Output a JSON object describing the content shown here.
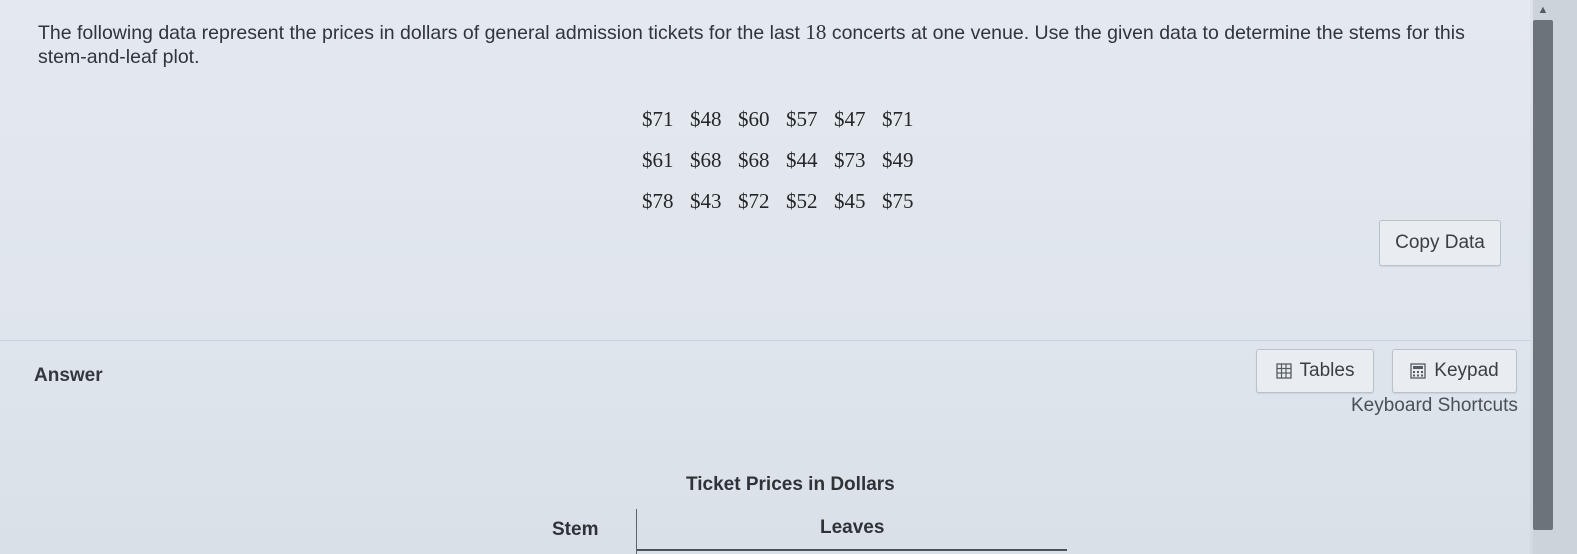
{
  "question": {
    "text_before": "The following data represent the prices in dollars of general admission tickets for the last ",
    "count": "18",
    "text_after": " concerts at one venue. Use the given data to determine the stems for this stem-and-leaf plot."
  },
  "prices": [
    [
      "$71",
      "$48",
      "$60",
      "$57",
      "$47",
      "$71"
    ],
    [
      "$61",
      "$68",
      "$68",
      "$44",
      "$73",
      "$49"
    ],
    [
      "$78",
      "$43",
      "$72",
      "$52",
      "$45",
      "$75"
    ]
  ],
  "copy_data_label": "Copy Data",
  "answer": {
    "label": "Answer",
    "tables_label": "Tables",
    "keypad_label": "Keypad",
    "shortcuts_label": "Keyboard Shortcuts",
    "plot_title": "Ticket Prices in Dollars",
    "stem_header": "Stem",
    "leaves_header": "Leaves"
  },
  "icons": {
    "tables": "table-grid-icon",
    "keypad": "calculator-icon",
    "scroll_up": "chevron-up-icon"
  }
}
